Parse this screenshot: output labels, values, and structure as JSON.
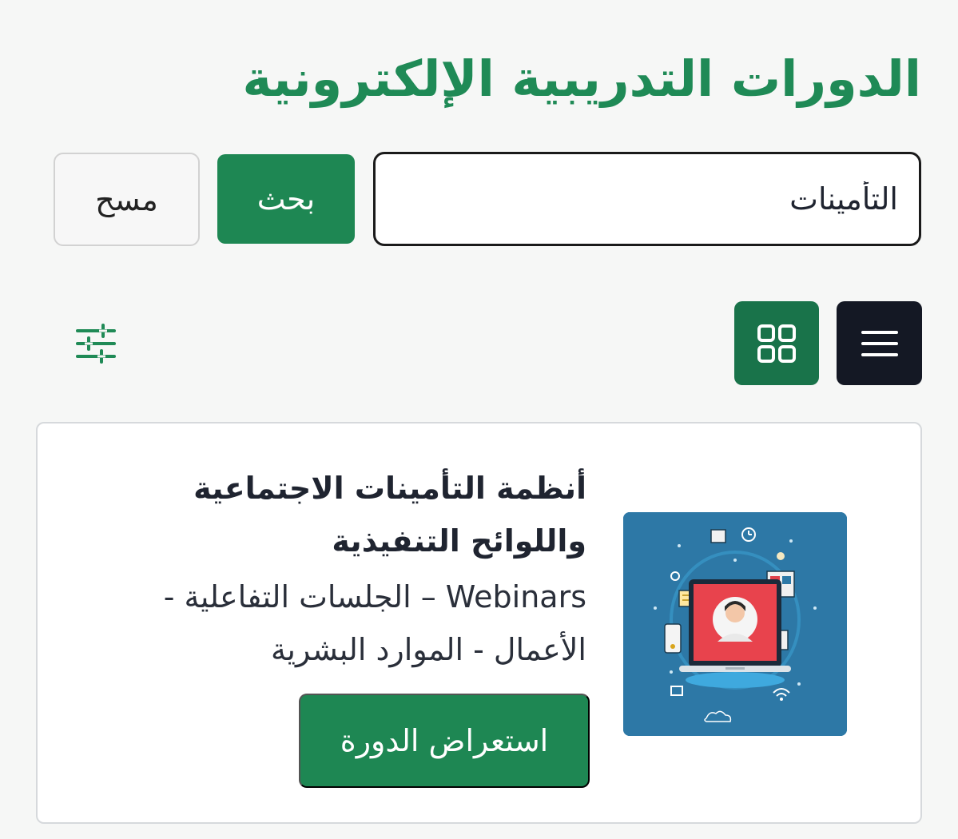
{
  "header": {
    "title": "الدورات التدريبية الإلكترونية"
  },
  "search": {
    "value": "التأمينات",
    "search_label": "بحث",
    "clear_label": "مسح"
  },
  "view_controls": {
    "list_icon": "hamburger-menu-icon",
    "grid_icon": "grid-icon",
    "filter_icon": "sliders-icon"
  },
  "course": {
    "title": "أنظمة التأمينات الاجتماعية واللوائح التنفيذية",
    "category": "Webinars – الجلسات التفاعلية - الأعمال - الموارد البشرية",
    "view_label": "استعراض الدورة",
    "thumbnail_icon": "online-webinar-illustration"
  },
  "colors": {
    "brand_green": "#1f8a56",
    "dark_green": "#19734a",
    "dark_navy": "#141824",
    "thumb_blue": "#2d78a6"
  }
}
